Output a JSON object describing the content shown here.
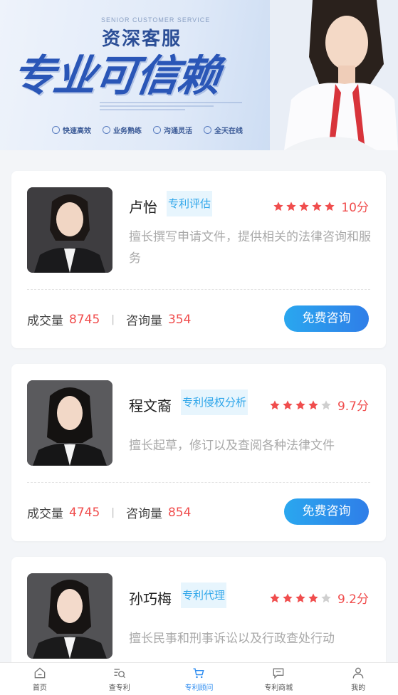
{
  "banner": {
    "subtitle": "SENIOR CUSTOMER SERVICE",
    "title": "资深客服",
    "slogan": "专业可信赖",
    "tags": [
      "快速高效",
      "业务熟练",
      "沟通灵活",
      "全天在线"
    ]
  },
  "colors": {
    "accent": "#2f8df0",
    "price_red": "#f04d4d",
    "tag_blue": "#2fa6ea"
  },
  "consultants": [
    {
      "name": "卢怡",
      "tag": "专利评估",
      "rating": 5,
      "score": "10分",
      "description": "擅长撰写申请文件，提供相关的法律咨询和服务",
      "deals_label": "成交量",
      "deals": "8745",
      "consults_label": "咨询量",
      "consults": "354",
      "button": "免费咨询"
    },
    {
      "name": "程文裔",
      "tag": "专利侵权分析",
      "rating": 4,
      "score": "9.7分",
      "description": "擅长起草，修订以及查阅各种法律文件",
      "deals_label": "成交量",
      "deals": "4745",
      "consults_label": "咨询量",
      "consults": "854",
      "button": "免费咨询"
    },
    {
      "name": "孙巧梅",
      "tag": "专利代理",
      "rating": 4,
      "score": "9.2分",
      "description": "擅长民事和刑事诉讼以及行政查处行动"
    }
  ],
  "tabbar": [
    {
      "label": "首页",
      "icon": "home-icon"
    },
    {
      "label": "查专利",
      "icon": "search-patent-icon"
    },
    {
      "label": "专利顾问",
      "icon": "cart-icon",
      "active": true
    },
    {
      "label": "专利商城",
      "icon": "message-icon"
    },
    {
      "label": "我的",
      "icon": "user-icon"
    }
  ]
}
